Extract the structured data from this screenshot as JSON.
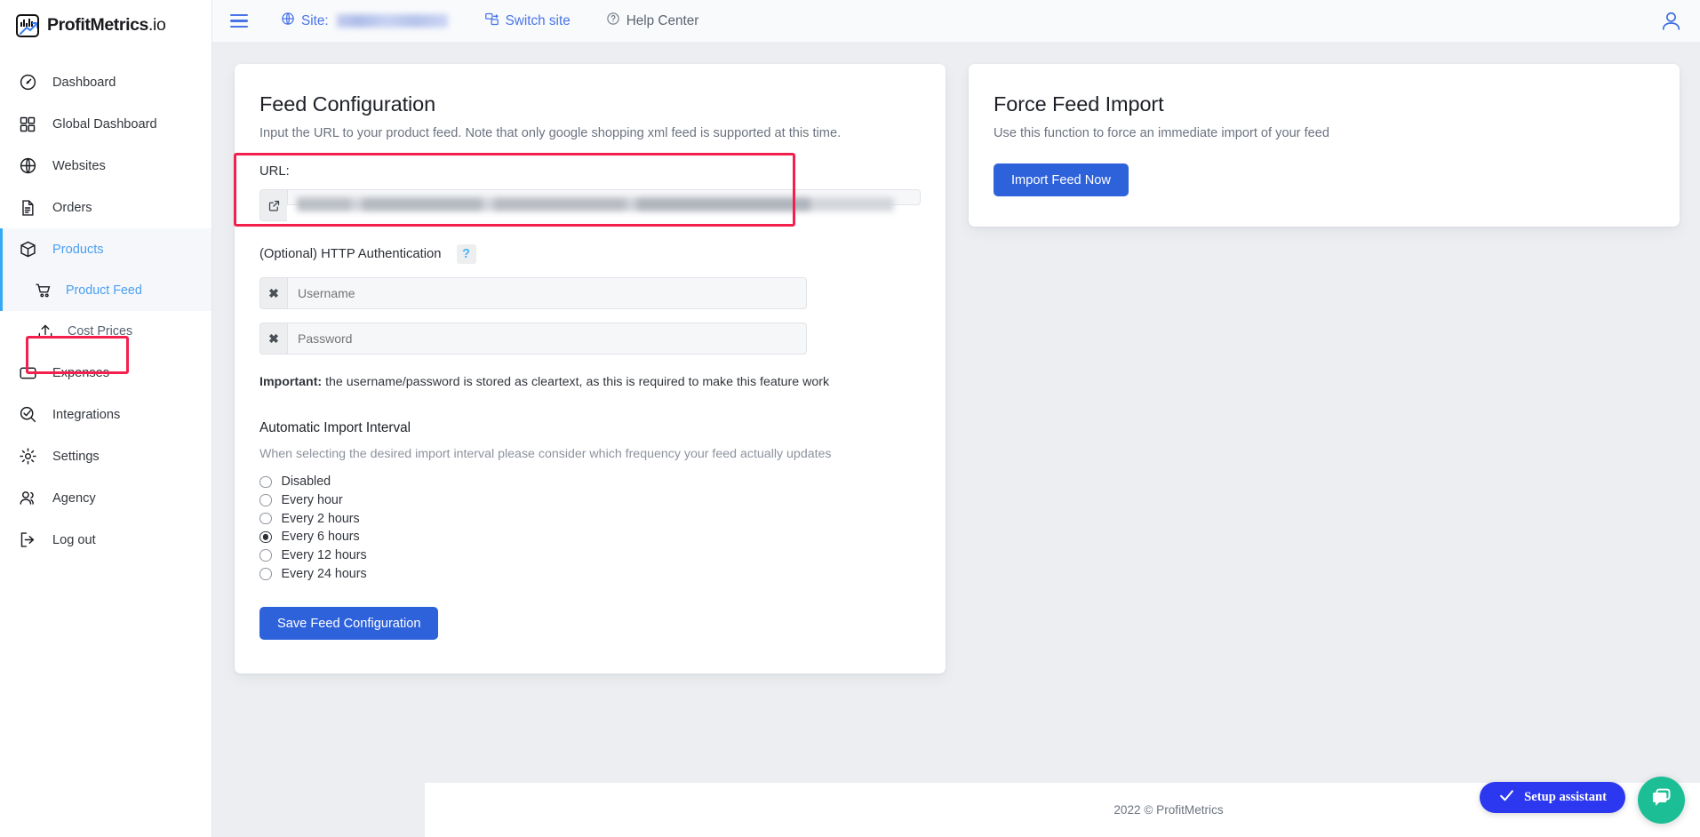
{
  "brand": {
    "name": "ProfitMetrics",
    "suffix": ".io",
    "logo_icon": "chart-logo-icon"
  },
  "sidebar": {
    "items": [
      {
        "label": "Dashboard",
        "icon": "gauge-icon",
        "active": false
      },
      {
        "label": "Global Dashboard",
        "icon": "grid-icon",
        "active": false
      },
      {
        "label": "Websites",
        "icon": "globe-icon",
        "active": false
      },
      {
        "label": "Orders",
        "icon": "document-icon",
        "active": false
      },
      {
        "label": "Products",
        "icon": "box-icon",
        "active": true
      }
    ],
    "sub_items": [
      {
        "label": "Product Feed",
        "icon": "shopping-cart-icon",
        "selected": true
      },
      {
        "label": "Cost Prices",
        "icon": "upload-icon",
        "selected": false
      }
    ],
    "items_after": [
      {
        "label": "Expenses",
        "icon": "wallet-icon"
      },
      {
        "label": "Integrations",
        "icon": "search-check-icon"
      },
      {
        "label": "Settings",
        "icon": "gear-icon"
      },
      {
        "label": "Agency",
        "icon": "users-icon"
      },
      {
        "label": "Log out",
        "icon": "logout-icon"
      }
    ]
  },
  "topbar": {
    "menu_icon": "hamburger-icon",
    "site_label": "Site:",
    "site_value": "",
    "site_icon": "globe-icon",
    "switch_site": "Switch site",
    "switch_site_icon": "switch-site-icon",
    "help_center": "Help Center",
    "help_center_icon": "question-circle-icon",
    "avatar_icon": "user-avatar-icon"
  },
  "feed_config": {
    "title": "Feed Configuration",
    "subtitle": "Input the URL to your product feed. Note that only google shopping xml feed is supported at this time.",
    "url_label": "URL:",
    "url_value": "",
    "url_addon_icon": "external-link-icon",
    "auth_label": "(Optional) HTTP Authentication",
    "help_badge": "?",
    "username_placeholder": "Username",
    "username_value": "",
    "password_placeholder": "Password",
    "password_value": "",
    "clear_icon": "x-icon",
    "important_bold": "Important:",
    "important_text": " the username/password is stored as cleartext, as this is required to make this feature work",
    "interval_title": "Automatic Import Interval",
    "interval_sub": "When selecting the desired import interval please consider which frequency your feed actually updates",
    "intervals": [
      {
        "label": "Disabled",
        "checked": false
      },
      {
        "label": "Every hour",
        "checked": false
      },
      {
        "label": "Every 2 hours",
        "checked": false
      },
      {
        "label": "Every 6 hours",
        "checked": true
      },
      {
        "label": "Every 12 hours",
        "checked": false
      },
      {
        "label": "Every 24 hours",
        "checked": false
      }
    ],
    "save_label": "Save Feed Configuration"
  },
  "force_import": {
    "title": "Force Feed Import",
    "subtitle": "Use this function to force an immediate import of your feed",
    "button_label": "Import Feed Now"
  },
  "footer": {
    "text": "2022 © ProfitMetrics"
  },
  "setup_assistant": {
    "label": "Setup assistant",
    "icon": "check-icon"
  },
  "chat": {
    "icon": "chat-bubble-icon"
  },
  "colors": {
    "accent_blue": "#2e62db",
    "link_blue": "#4874e8",
    "active_blue": "#4a9ff0",
    "highlight_red": "#f3204e",
    "chat_green": "#1cbf95",
    "setup_blue": "#2b38ef"
  }
}
